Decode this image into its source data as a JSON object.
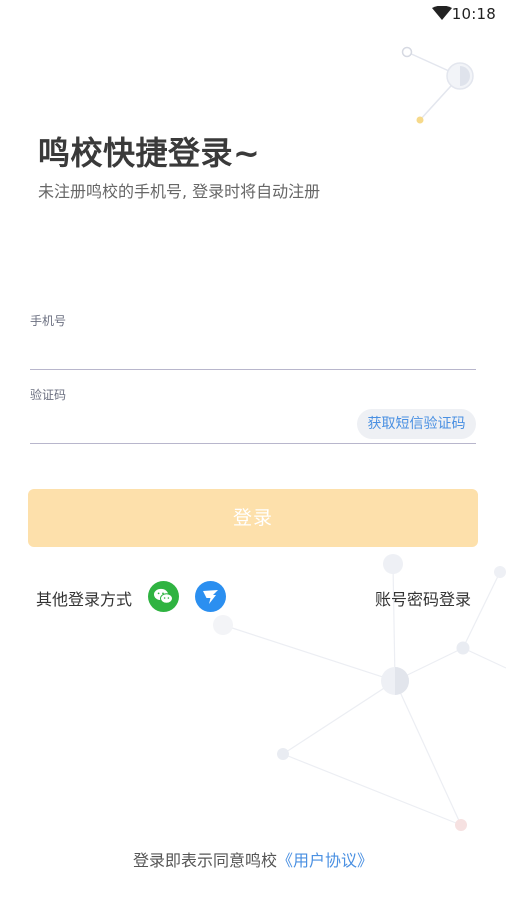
{
  "status_bar": {
    "time": "10:18",
    "wifi_icon": "wifi-icon"
  },
  "header": {
    "title": "鸣校快捷登录~",
    "subtitle": "未注册鸣校的手机号, 登录时将自动注册"
  },
  "form": {
    "phone_label": "手机号",
    "phone_value": "",
    "code_label": "验证码",
    "code_value": "",
    "get_code_label": "获取短信验证码",
    "login_label": "登录"
  },
  "other_login": {
    "label": "其他登录方式",
    "icons": [
      "wechat-icon",
      "dingtalk-icon"
    ],
    "password_login_label": "账号密码登录"
  },
  "agreement": {
    "prefix": "登录即表示同意鸣校",
    "link": "《用户协议》"
  },
  "colors": {
    "accent_blue": "#4a90e2",
    "login_button": "#fde0ab",
    "wechat_green": "#2fb341",
    "dingtalk_blue": "#2b8ff0"
  }
}
